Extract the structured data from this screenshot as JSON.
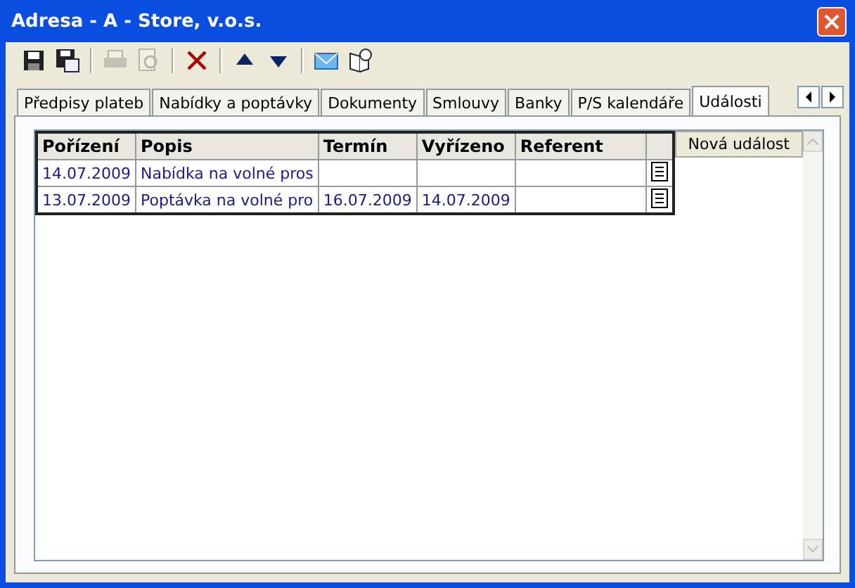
{
  "window": {
    "title": "Adresa - A - Store, v.o.s."
  },
  "toolbar": [
    {
      "kind": "save",
      "disabled": false
    },
    {
      "kind": "save-as",
      "disabled": false
    },
    {
      "kind": "separator"
    },
    {
      "kind": "print",
      "disabled": true
    },
    {
      "kind": "preview",
      "disabled": true
    },
    {
      "kind": "separator"
    },
    {
      "kind": "delete",
      "disabled": false
    },
    {
      "kind": "separator"
    },
    {
      "kind": "up",
      "disabled": false
    },
    {
      "kind": "down",
      "disabled": false
    },
    {
      "kind": "separator"
    },
    {
      "kind": "mail",
      "disabled": false
    },
    {
      "kind": "book",
      "disabled": false
    }
  ],
  "tabs": [
    {
      "label": "Předpisy plateb",
      "selected": false
    },
    {
      "label": "Nabídky a poptávky",
      "selected": false
    },
    {
      "label": "Dokumenty",
      "selected": false
    },
    {
      "label": "Smlouvy",
      "selected": false
    },
    {
      "label": "Banky",
      "selected": false
    },
    {
      "label": "P/S kalendáře",
      "selected": false
    },
    {
      "label": "Události",
      "selected": true
    }
  ],
  "table": {
    "columns": [
      "Pořízení",
      "Popis",
      "Termín",
      "Vyřízeno",
      "Referent"
    ],
    "rows": [
      {
        "cells": [
          "14.07.2009",
          "Nabídka na volné pros",
          "",
          "",
          ""
        ]
      },
      {
        "cells": [
          "13.07.2009",
          "Poptávka na volné pro",
          "16.07.2009",
          "14.07.2009",
          ""
        ]
      }
    ]
  },
  "new_button": "Nová událost"
}
